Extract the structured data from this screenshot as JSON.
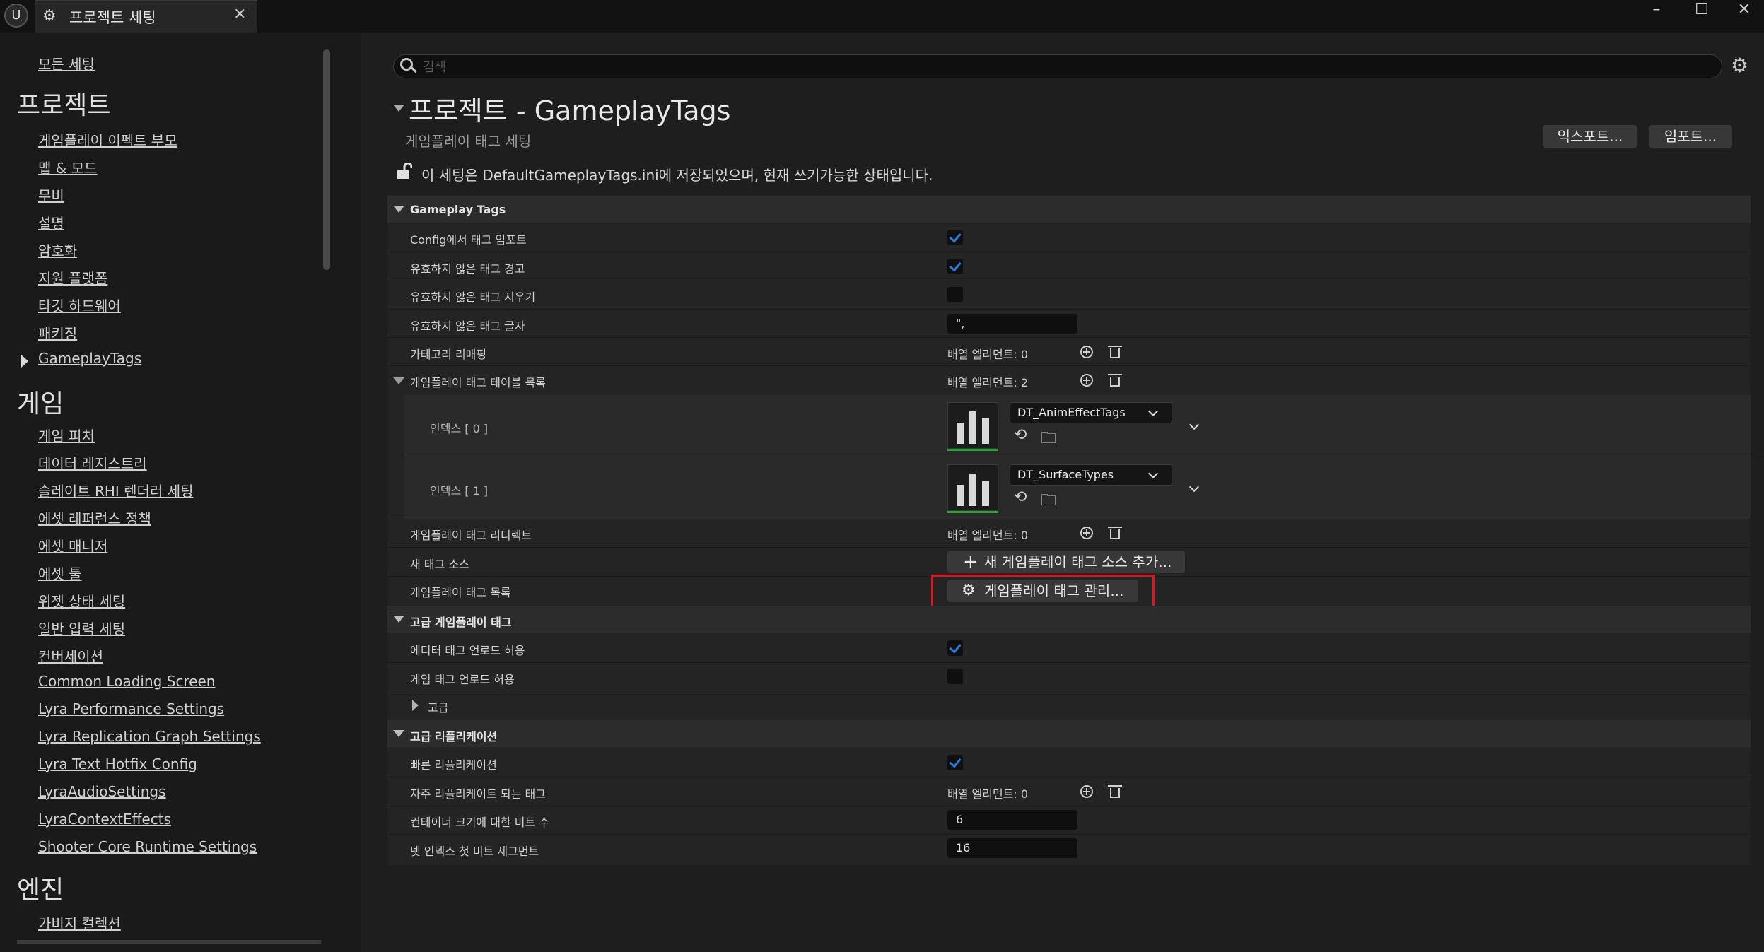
{
  "window": {
    "tab_title": "프로젝트 세팅",
    "tab_close": "×",
    "minimize": "–",
    "maximize": "☐",
    "close": "✕"
  },
  "sidebar": {
    "all_settings": "모든 세팅",
    "categories": [
      {
        "title": "프로젝트",
        "items": [
          "게임플레이 이펙트 부모",
          "맵 & 모드",
          "무비",
          "설명",
          "암호화",
          "지원 플랫폼",
          "타깃 하드웨어",
          "패키징",
          "GameplayTags"
        ]
      },
      {
        "title": "게임",
        "items": [
          "게임 피처",
          "데이터 레지스트리",
          "슬레이트 RHI 렌더러 세팅",
          "에셋 레퍼런스 정책",
          "에셋 매니저",
          "에셋 툴",
          "위젯 상태 세팅",
          "일반 입력 세팅",
          "컨버세이션",
          "Common Loading Screen",
          "Lyra Performance Settings",
          "Lyra Replication Graph Settings",
          "Lyra Text Hotfix Config",
          "LyraAudioSettings",
          "LyraContextEffects",
          "Shooter Core Runtime Settings"
        ]
      },
      {
        "title": "엔진",
        "items": [
          "가비지 컬렉션"
        ]
      }
    ]
  },
  "search": {
    "placeholder": "검색"
  },
  "header": {
    "title": "프로젝트 - GameplayTags",
    "subtitle": "게임플레이 태그 세팅",
    "export_label": "익스포트...",
    "import_label": "임포트...",
    "notice": "이 세팅은 DefaultGameplayTags.ini에 저장되었으며, 현재 쓰기가능한 상태입니다."
  },
  "sections": {
    "gameplay_tags": {
      "title": "Gameplay Tags",
      "import_from_config": "Config에서 태그 임포트",
      "warn_invalid": "유효하지 않은 태그 경고",
      "clear_invalid": "유효하지 않은 태그 지우기",
      "invalid_chars": "유효하지 않은 태그 글자",
      "invalid_chars_value": "\",",
      "category_remap": "카테고리 리매핑",
      "category_remap_count": "배열 엘리먼트: 0",
      "table_list": "게임플레이 태그 테이블 목록",
      "table_list_count": "배열 엘리먼트: 2",
      "index0_label": "인덱스 [ 0 ]",
      "index0_value": "DT_AnimEffectTags",
      "index1_label": "인덱스 [ 1 ]",
      "index1_value": "DT_SurfaceTypes",
      "redirects": "게임플레이 태그 리디렉트",
      "redirects_count": "배열 엘리먼트: 0",
      "new_source": "새 태그 소스",
      "new_source_button": "새 게임플레이 태그 소스 추가...",
      "tag_list": "게임플레이 태그 목록",
      "manage_button": "게임플레이 태그 관리..."
    },
    "advanced_tags": {
      "title": "고급 게임플레이 태그",
      "editor_unload": "에디터 태그 언로드 허용",
      "game_unload": "게임 태그 언로드 허용",
      "advanced": "고급"
    },
    "advanced_replication": {
      "title": "고급 리플리케이션",
      "fast_replication": "빠른 리플리케이션",
      "common_tags": "자주 리플리케이트 되는 태그",
      "common_tags_count": "배열 엘리먼트: 0",
      "container_bits": "컨테이너 크기에 대한 비트 수",
      "container_bits_value": "6",
      "net_index_bits": "넷 인덱스 첫 비트 세그먼트",
      "net_index_bits_value": "16"
    }
  },
  "checkbox_states": {
    "import_from_config": true,
    "warn_invalid": true,
    "clear_invalid": false,
    "editor_unload": true,
    "game_unload": false,
    "fast_replication": true
  },
  "colors": {
    "accent_check": "#2d7ad9",
    "highlight_box": "#e0141e",
    "asset_underline": "#2aa03a"
  }
}
